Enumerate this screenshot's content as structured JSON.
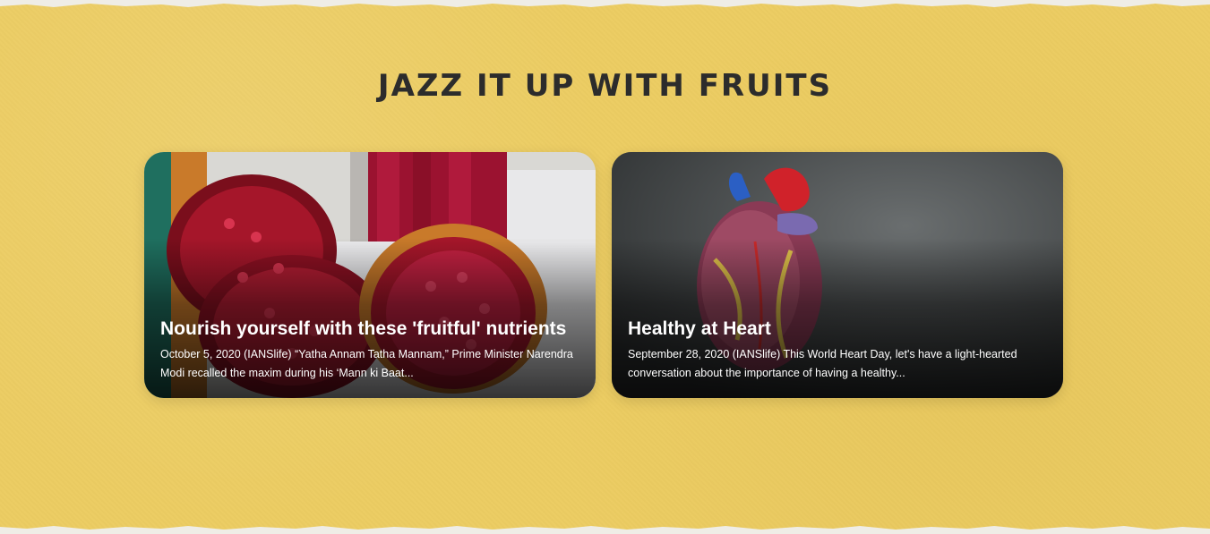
{
  "section": {
    "title": "JAZZ IT UP WITH FRUITS"
  },
  "cards": [
    {
      "title": "Nourish yourself with these 'fruitful' nutrients",
      "excerpt": "October 5, 2020 (IANSlife) “Yatha Annam Tatha Mannam,” Prime Minister Narendra Modi recalled the maxim during his ‘Mann ki Baat...",
      "image": "pomegranate-image"
    },
    {
      "title": "Healthy at Heart",
      "excerpt": "September 28, 2020 (IANSlife) This World Heart Day, let's have a light-hearted conversation about the importance of having a healthy...",
      "image": "heart-model-image"
    }
  ],
  "colors": {
    "background": "#eccc62",
    "title": "#2c2c2c",
    "card_text": "#ffffff"
  }
}
